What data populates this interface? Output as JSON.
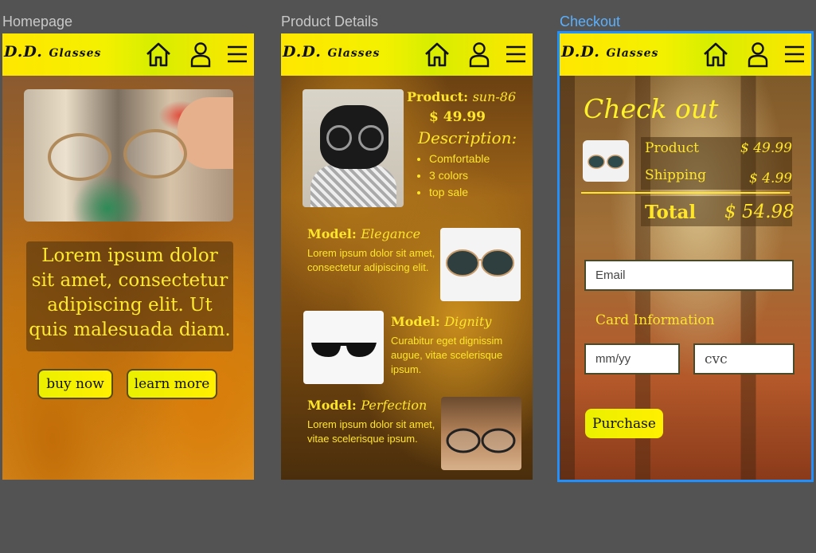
{
  "frames": {
    "homepage_label": "Homepage",
    "product_label": "Product Details",
    "checkout_label": "Checkout"
  },
  "header": {
    "logo_main": "D.D.",
    "logo_sub": "Glasses",
    "icons": [
      "home-icon",
      "user-icon",
      "menu-icon"
    ]
  },
  "homepage": {
    "hero_text": "Lorem ipsum dolor sit amet, consectetur adipiscing elit. Ut quis malesuada diam.",
    "buy_label": "buy now",
    "learn_label": "learn more"
  },
  "product": {
    "product_label": "Product:",
    "product_code": "sun-86",
    "price": "$ 49.99",
    "description_label": "Description:",
    "features": [
      "Comfortable",
      "3 colors",
      "top sale"
    ],
    "models": [
      {
        "label": "Model:",
        "name": "Elegance",
        "body": "Lorem ipsum dolor sit amet, consectetur adipiscing elit."
      },
      {
        "label": "Model:",
        "name": "Dignity",
        "body": "Curabitur eget dignissim augue, vitae scelerisque ipsum."
      },
      {
        "label": "Model:",
        "name": "Perfection",
        "body": "Lorem ipsum dolor sit amet, vitae scelerisque ipsum."
      }
    ]
  },
  "checkout": {
    "title": "Check out",
    "product_label": "Product",
    "product_price": "$ 49.99",
    "shipping_label": "Shipping",
    "shipping_price": "$ 4.99",
    "total_label": "Total",
    "total_price": "$ 54.98",
    "email_placeholder": "Email",
    "card_label": "Card Information",
    "expiry_placeholder": "mm/yy",
    "cvc_placeholder": "cvc",
    "purchase_label": "Purchase"
  },
  "colors": {
    "accent_yellow": "#ffe62a",
    "selection_blue": "#1e90ff",
    "canvas": "#535353"
  }
}
